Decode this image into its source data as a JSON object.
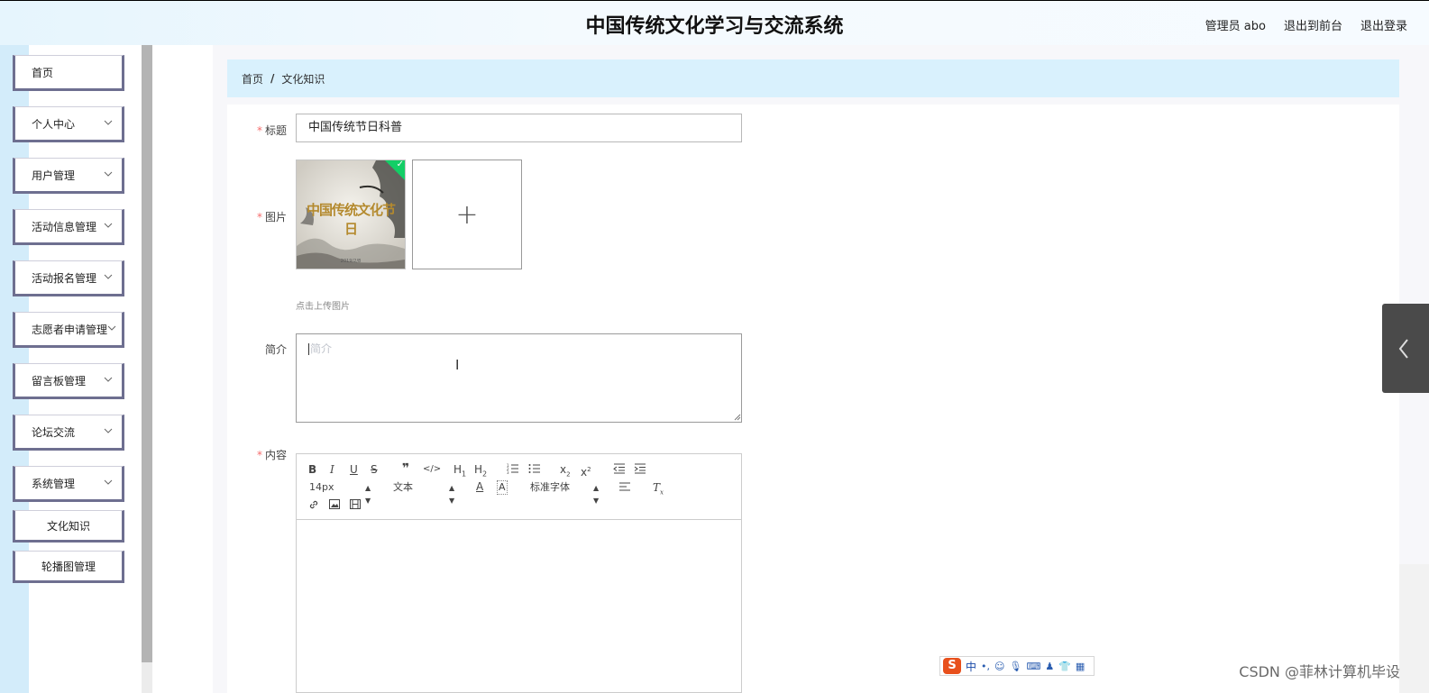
{
  "header": {
    "title": "中国传统文化学习与交流系统",
    "links": [
      "管理员 abo",
      "退出到前台",
      "退出登录"
    ]
  },
  "sidebar": {
    "items": [
      {
        "label": "首页",
        "expandable": false
      },
      {
        "label": "个人中心",
        "expandable": true
      },
      {
        "label": "用户管理",
        "expandable": true
      },
      {
        "label": "活动信息管理",
        "expandable": true
      },
      {
        "label": "活动报名管理",
        "expandable": true
      },
      {
        "label": "志愿者申请管理",
        "expandable": true
      },
      {
        "label": "留言板管理",
        "expandable": true
      },
      {
        "label": "论坛交流",
        "expandable": true
      },
      {
        "label": "系统管理",
        "expandable": true
      }
    ],
    "subitems": [
      "文化知识",
      "轮播图管理"
    ]
  },
  "breadcrumb": {
    "home": "首页",
    "separator": "/",
    "current": "文化知识"
  },
  "form": {
    "title_label": "标题",
    "title_value": "中国传统节日科普",
    "image_label": "图片",
    "image_thumb_text": "中国传统文化节日",
    "image_thumb_small": "2019/2/8",
    "upload_plus": "+",
    "upload_hint": "点击上传图片",
    "intro_label": "简介",
    "intro_placeholder": "简介",
    "content_label": "内容",
    "required_mark": "*"
  },
  "editor": {
    "font_size": "14px",
    "header_select": "文本",
    "font_family": "标准字体",
    "toolbar_icons": [
      "bold-icon",
      "italic-icon",
      "underline-icon",
      "strike-icon",
      "blockquote-icon",
      "code-block-icon",
      "header1-icon",
      "header2-icon",
      "ordered-list-icon",
      "bullet-list-icon",
      "subscript-icon",
      "superscript-icon",
      "outdent-icon",
      "indent-icon",
      "font-color-icon",
      "background-color-icon",
      "align-icon",
      "clean-format-icon",
      "link-icon",
      "image-icon",
      "video-icon"
    ]
  },
  "ime": {
    "char": "中",
    "logo": "S"
  },
  "watermark": "CSDN @菲林计算机毕设",
  "colors": {
    "required": "#f56c6c",
    "sidebar_border": "#6e6f90",
    "breadcrumb_bg": "#d9f1fd",
    "check": "#13ce66"
  }
}
